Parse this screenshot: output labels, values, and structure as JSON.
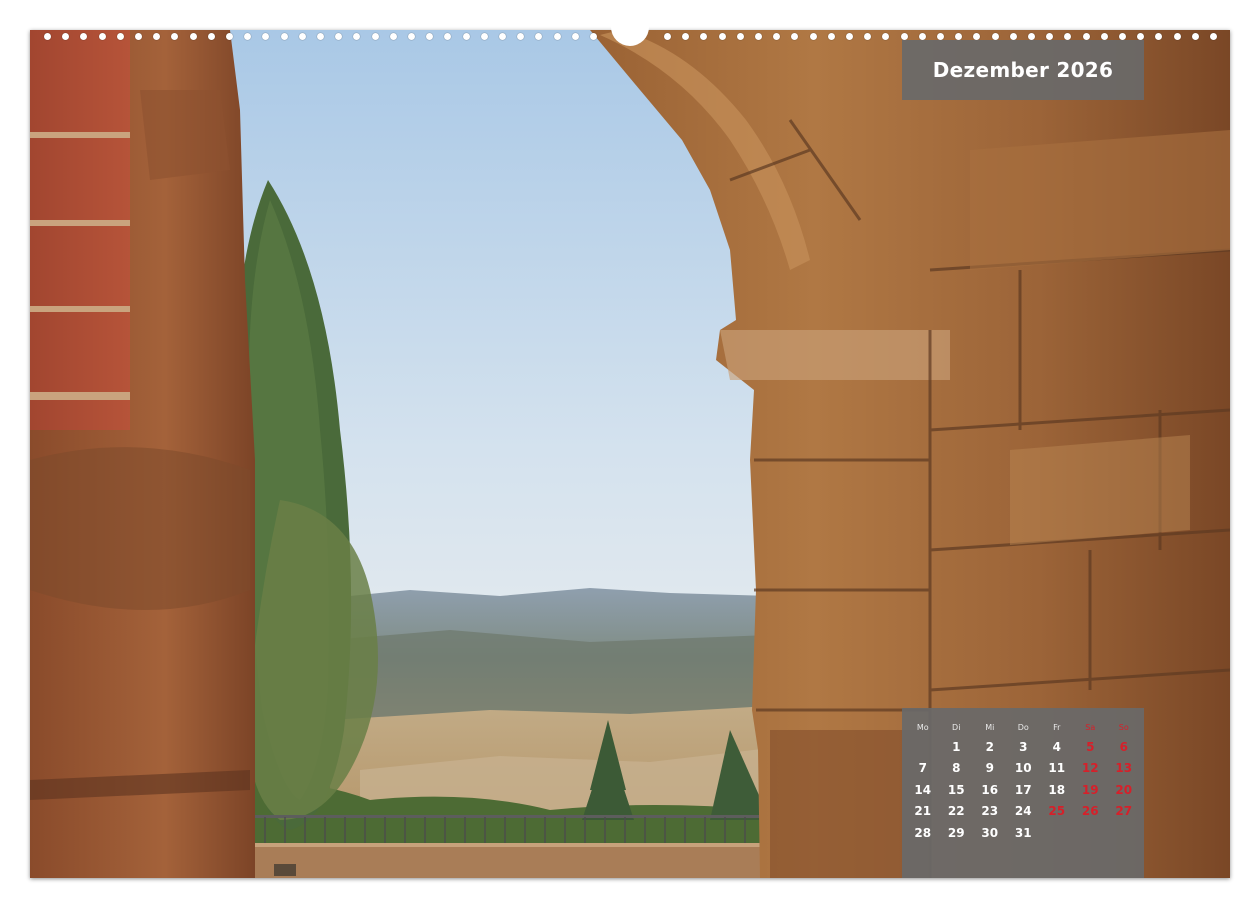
{
  "calendar": {
    "month_title": "Dezember 2026",
    "weekdays": [
      "Mo",
      "Di",
      "Mi",
      "Do",
      "Fr",
      "Sa",
      "So"
    ],
    "weeks": [
      [
        "",
        "1",
        "2",
        "3",
        "4",
        "5",
        "6"
      ],
      [
        "7",
        "8",
        "9",
        "10",
        "11",
        "12",
        "13"
      ],
      [
        "14",
        "15",
        "16",
        "17",
        "18",
        "19",
        "20"
      ],
      [
        "21",
        "22",
        "23",
        "24",
        "25",
        "26",
        "27"
      ],
      [
        "28",
        "29",
        "30",
        "31",
        "",
        "",
        ""
      ]
    ],
    "holidays": [
      "25",
      "26"
    ]
  },
  "colors": {
    "panel": "#696969",
    "text": "#ffffff",
    "weekend_red": "#d6202a"
  },
  "photo": {
    "subject_icon": "stone-arch-landscape-photo"
  }
}
